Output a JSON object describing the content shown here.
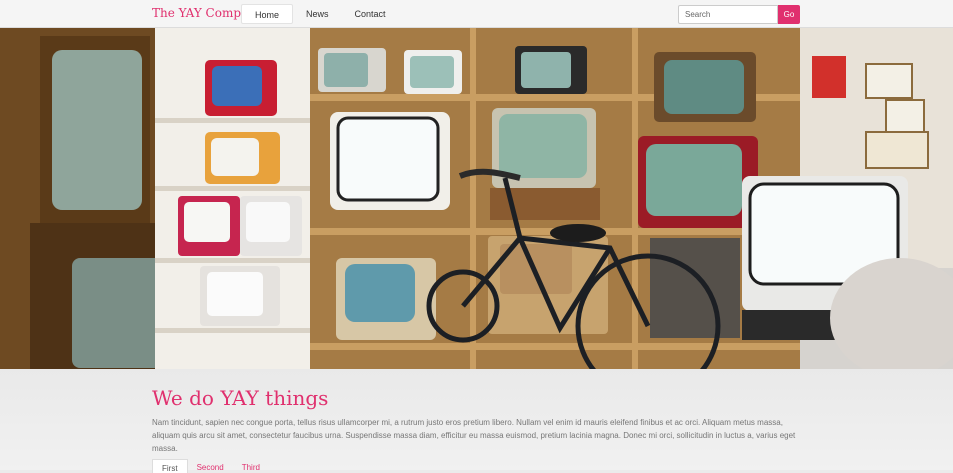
{
  "navbar": {
    "brand": "The YAY Company",
    "links": [
      {
        "label": "Home",
        "active": true
      },
      {
        "label": "News",
        "active": false
      },
      {
        "label": "Contact",
        "active": false
      }
    ],
    "search": {
      "placeholder": "Search",
      "button": "Go"
    }
  },
  "colors": {
    "accent": "#e0306e"
  },
  "carousel": {
    "slide_count": 3,
    "active_index": 0
  },
  "main": {
    "headline": "We do YAY things",
    "paragraph": "Nam tincidunt, sapien nec congue porta, tellus risus ullamcorper mi, a rutrum justo eros pretium libero. Nullam vel enim id mauris eleifend finibus et ac orci. Aliquam metus massa, aliquam quis arcu sit amet, consectetur faucibus urna. Suspendisse massa diam, efficitur eu massa euismod, pretium lacinia magna. Donec mi orci, sollicitudin in luctus a, varius eget massa.",
    "tabs": [
      {
        "label": "First",
        "active": true
      },
      {
        "label": "Second",
        "active": false
      },
      {
        "label": "Third",
        "active": false
      }
    ]
  }
}
